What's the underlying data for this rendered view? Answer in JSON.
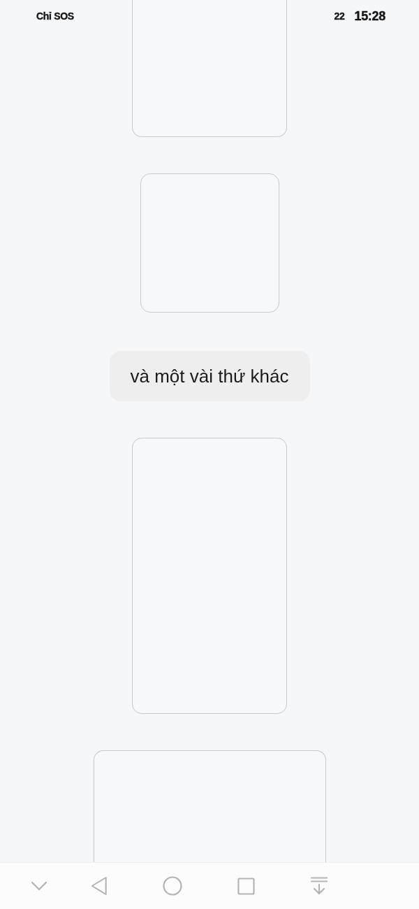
{
  "status_bar": {
    "carrier": "Chỉ SOS",
    "battery": "22",
    "time": "15:28"
  },
  "feed": [
    {
      "kind": "portrait"
    },
    {
      "kind": "square"
    },
    {
      "kind": "chip",
      "text": "và một vài thứ khác"
    },
    {
      "kind": "portrait"
    },
    {
      "kind": "wide"
    }
  ]
}
